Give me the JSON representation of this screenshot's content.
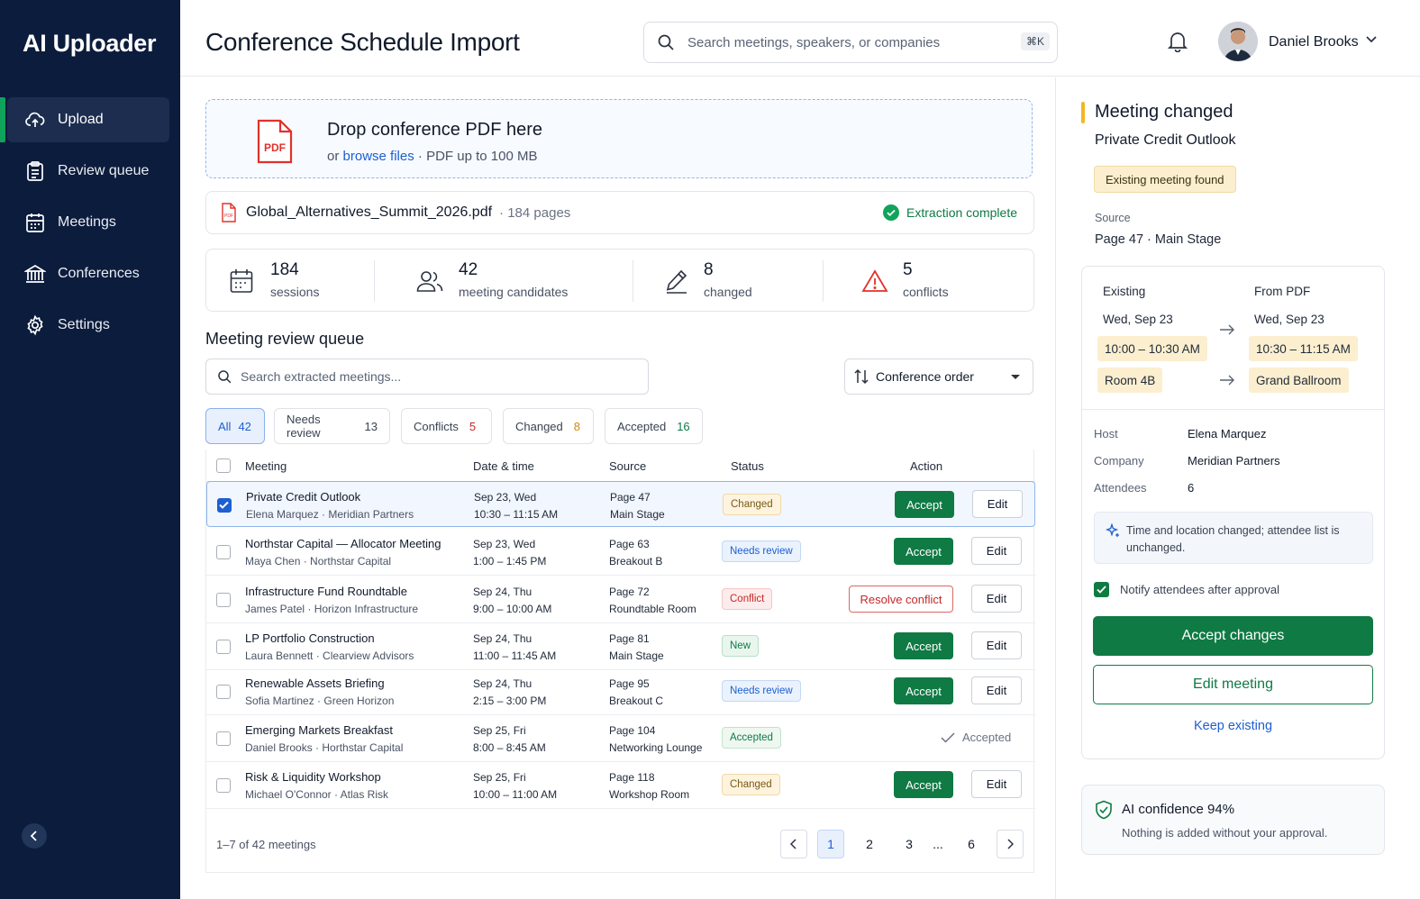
{
  "app": {
    "brand": "AI Uploader"
  },
  "sidebar": {
    "items": [
      {
        "label": "Upload",
        "icon": "cloud-upload-icon"
      },
      {
        "label": "Review queue",
        "icon": "clipboard-icon"
      },
      {
        "label": "Meetings",
        "icon": "calendar-icon"
      },
      {
        "label": "Conferences",
        "icon": "building-icon"
      },
      {
        "label": "Settings",
        "icon": "gear-icon"
      }
    ],
    "active": "Upload"
  },
  "header": {
    "title": "Conference Schedule Import",
    "search_placeholder": "Search meetings, speakers, or companies",
    "search_shortcut": "⌘K",
    "user_name": "Daniel Brooks"
  },
  "upload": {
    "title": "Drop conference PDF here",
    "or": "or",
    "browse": "browse files",
    "limit": "PDF up to 100 MB",
    "file_icon_label": "PDF"
  },
  "file": {
    "name": "Global_Alternatives_Summit_2026.pdf",
    "pages": "184 pages",
    "status": "Extraction complete"
  },
  "stats": [
    {
      "value": "184",
      "label": "sessions",
      "icon": "calendar-icon"
    },
    {
      "value": "42",
      "label": "meeting candidates",
      "icon": "users-icon"
    },
    {
      "value": "8",
      "label": "changed",
      "icon": "pencil-icon"
    },
    {
      "value": "5",
      "label": "conflicts",
      "icon": "warning-icon"
    }
  ],
  "queue": {
    "title": "Meeting review queue",
    "search_placeholder": "Search extracted meetings...",
    "sort_label": "Conference order",
    "tabs": [
      {
        "label": "All",
        "count": "42",
        "color": "#1d5fd0"
      },
      {
        "label": "Needs review",
        "count": "13",
        "color": "#3a4353"
      },
      {
        "label": "Conflicts",
        "count": "5",
        "color": "#c62828"
      },
      {
        "label": "Changed",
        "count": "8",
        "color": "#d08a12"
      },
      {
        "label": "Accepted",
        "count": "16",
        "color": "#0e7a45"
      }
    ],
    "columns": [
      "Meeting",
      "Date & time",
      "Source",
      "Status",
      "Action"
    ],
    "rows": [
      {
        "title": "Private Credit Outlook",
        "sub": "Elena Marquez · Meridian Partners",
        "date": "Sep 23, Wed",
        "time": "10:30 – 11:15 AM",
        "page": "Page 47",
        "room": "Main Stage",
        "status": "Changed",
        "status_kind": "changed",
        "action": "accept",
        "selected": true
      },
      {
        "title": "Northstar Capital — Allocator Meeting",
        "sub": "Maya Chen · Northstar Capital",
        "date": "Sep 23, Wed",
        "time": "1:00 – 1:45 PM",
        "page": "Page 63",
        "room": "Breakout B",
        "status": "Needs review",
        "status_kind": "review",
        "action": "accept",
        "selected": false
      },
      {
        "title": "Infrastructure Fund Roundtable",
        "sub": "James Patel · Horizon Infrastructure",
        "date": "Sep 24, Thu",
        "time": "9:00 – 10:00 AM",
        "page": "Page 72",
        "room": "Roundtable Room",
        "status": "Conflict",
        "status_kind": "conflict",
        "action": "resolve",
        "selected": false
      },
      {
        "title": "LP Portfolio Construction",
        "sub": "Laura Bennett · Clearview Advisors",
        "date": "Sep 24, Thu",
        "time": "11:00 – 11:45 AM",
        "page": "Page 81",
        "room": "Main Stage",
        "status": "New",
        "status_kind": "new",
        "action": "accept",
        "selected": false
      },
      {
        "title": "Renewable Assets Briefing",
        "sub": "Sofia Martinez · Green Horizon",
        "date": "Sep 24, Thu",
        "time": "2:15 – 3:00 PM",
        "page": "Page 95",
        "room": "Breakout C",
        "status": "Needs review",
        "status_kind": "review",
        "action": "accept",
        "selected": false
      },
      {
        "title": "Emerging Markets Breakfast",
        "sub": "Daniel Brooks · Horthstar Capital",
        "date": "Sep 25, Fri",
        "time": "8:00 – 8:45 AM",
        "page": "Page 104",
        "room": "Networking Lounge",
        "status": "Accepted",
        "status_kind": "accepted",
        "action": "accepted",
        "selected": false
      },
      {
        "title": "Risk & Liquidity Workshop",
        "sub": "Michael O'Connor · Atlas Risk",
        "date": "Sep 25, Fri",
        "time": "10:00 – 11:00 AM",
        "page": "Page 118",
        "room": "Workshop Room",
        "status": "Changed",
        "status_kind": "changed",
        "action": "accept",
        "selected": false
      }
    ],
    "accept_label": "Accept",
    "edit_label": "Edit",
    "resolve_label": "Resolve conflict",
    "accepted_label": "Accepted",
    "footer_count": "1–7 of 42 meetings",
    "pages": [
      "1",
      "2",
      "3",
      "...",
      "6"
    ],
    "current_page": "1"
  },
  "detail": {
    "title": "Meeting changed",
    "meeting": "Private Credit Outlook",
    "badge": "Existing meeting found",
    "source_label": "Source",
    "source_value": "Page 47 · Main Stage",
    "existing_label": "Existing",
    "pdf_label": "From PDF",
    "existing": {
      "date": "Wed, Sep 23",
      "time": "10:00 – 10:30 AM",
      "room": "Room 4B"
    },
    "from_pdf": {
      "date": "Wed, Sep 23",
      "time": "10:30 – 11:15 AM",
      "room": "Grand Ballroom"
    },
    "fields": [
      {
        "key": "Host",
        "value": "Elena Marquez"
      },
      {
        "key": "Company",
        "value": "Meridian Partners"
      },
      {
        "key": "Attendees",
        "value": "6"
      }
    ],
    "note": "Time and location changed; attendee list is unchanged.",
    "notify_label": "Notify attendees after approval",
    "notify_checked": true,
    "accept_changes": "Accept changes",
    "edit_meeting": "Edit meeting",
    "keep_existing": "Keep existing",
    "confidence_title": "AI confidence 94%",
    "confidence_sub": "Nothing is added without your approval."
  },
  "colors": {
    "sidebar_bg": "#0c1c3c",
    "accent_green": "#0f7a44",
    "accent_blue": "#1d5fd0",
    "changed_yellow": "#f2b627"
  }
}
